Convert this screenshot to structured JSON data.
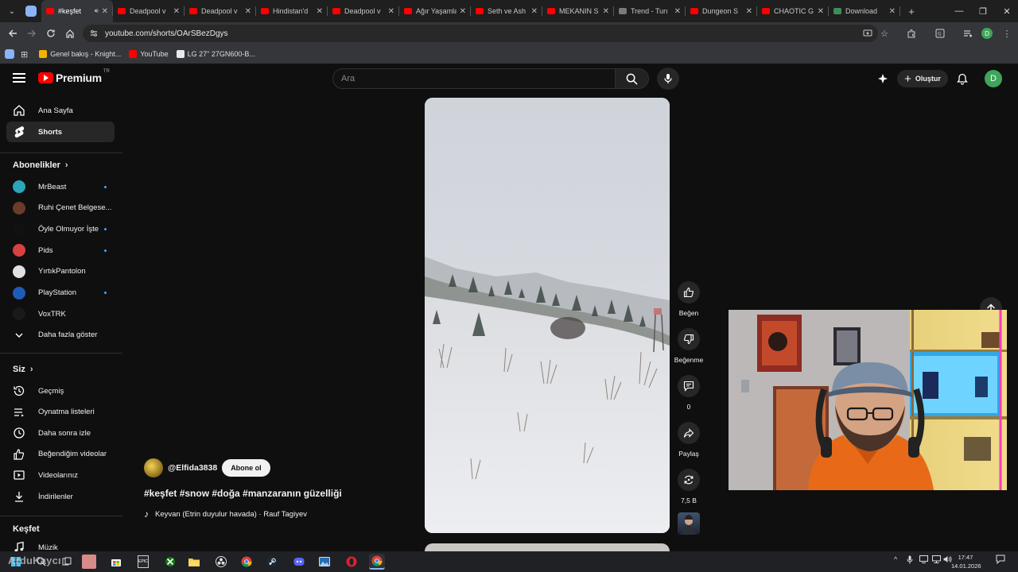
{
  "browser": {
    "tabs": [
      {
        "label": "#keşfet",
        "active": true,
        "favicon": "youtube"
      },
      {
        "label": "Deadpool v",
        "favicon": "youtube"
      },
      {
        "label": "Deadpool v",
        "favicon": "youtube"
      },
      {
        "label": "Hindistan'd",
        "favicon": "youtube"
      },
      {
        "label": "Deadpool v",
        "favicon": "youtube"
      },
      {
        "label": "Ağır Yaşamla",
        "favicon": "youtube"
      },
      {
        "label": "Seth ve Ash",
        "favicon": "youtube"
      },
      {
        "label": "MEKANIN S",
        "favicon": "youtube"
      },
      {
        "label": "Trend - Turı",
        "favicon": "other"
      },
      {
        "label": "Dungeon S",
        "favicon": "youtube"
      },
      {
        "label": "CHAOTIC G",
        "favicon": "youtube"
      },
      {
        "label": "Download",
        "favicon": "green"
      }
    ],
    "url": "youtube.com/shorts/OArSBezDgys",
    "profile_initial": "D",
    "bookmarks": [
      {
        "label": "Genel bakış - Knight...",
        "color": "#f4b400"
      },
      {
        "label": "YouTube",
        "color": "#ff0000"
      },
      {
        "label": "LG 27\" 27GN600-B...",
        "color": "#e8eaed"
      }
    ]
  },
  "youtube": {
    "logo_text": "Premium",
    "logo_region": "TR",
    "search_placeholder": "Ara",
    "create_label": "Oluştur",
    "avatar_initial": "D",
    "sidebar": {
      "main": [
        {
          "label": "Ana Sayfa",
          "icon": "home-icon"
        },
        {
          "label": "Shorts",
          "icon": "shorts-icon",
          "active": true
        }
      ],
      "subscriptions_header": "Abonelikler",
      "subscriptions": [
        {
          "label": "MrBeast",
          "color": "#2aa6b8",
          "new": true
        },
        {
          "label": "Ruhi Çenet Belgese...",
          "color": "#6a3b2a",
          "new": false
        },
        {
          "label": "Öyle Olmuyor İşte",
          "color": "#111111",
          "new": true
        },
        {
          "label": "Pids",
          "color": "#d94040",
          "new": true
        },
        {
          "label": "YırtıkPantolon",
          "color": "#e0e0e0",
          "new": false
        },
        {
          "label": "PlayStation",
          "color": "#1f5bb8",
          "new": true
        },
        {
          "label": "VoxTRK",
          "color": "#1a1a1a",
          "new": false
        },
        {
          "label": "Daha fazla göster",
          "icon": "chevron-down-icon"
        }
      ],
      "you_header": "Siz",
      "you": [
        {
          "label": "Geçmiş",
          "icon": "history-icon"
        },
        {
          "label": "Oynatma listeleri",
          "icon": "playlists-icon"
        },
        {
          "label": "Daha sonra izle",
          "icon": "clock-icon"
        },
        {
          "label": "Beğendiğim videolar",
          "icon": "like-icon"
        },
        {
          "label": "Videolarınız",
          "icon": "your-videos-icon"
        },
        {
          "label": "İndirilenler",
          "icon": "download-icon"
        }
      ],
      "explore_header": "Keşfet",
      "explore": [
        {
          "label": "Müzik",
          "icon": "music-icon"
        }
      ]
    },
    "short": {
      "channel": "@Elfida3838",
      "subscribe_label": "Abone ol",
      "title": "#keşfet #snow #doğa #manzaranın güzelliği",
      "music": "Keyvan (Etrin duyulur havada) · Rauf Tagiyev",
      "actions": {
        "like": "Beğen",
        "dislike": "Beğenme",
        "comments": "0",
        "share": "Paylaş",
        "remix": "7,5 B"
      }
    }
  },
  "stream": {
    "watermark": "ArduKaycı"
  },
  "taskbar": {
    "time": "17:47",
    "date": "14.01.2026"
  }
}
